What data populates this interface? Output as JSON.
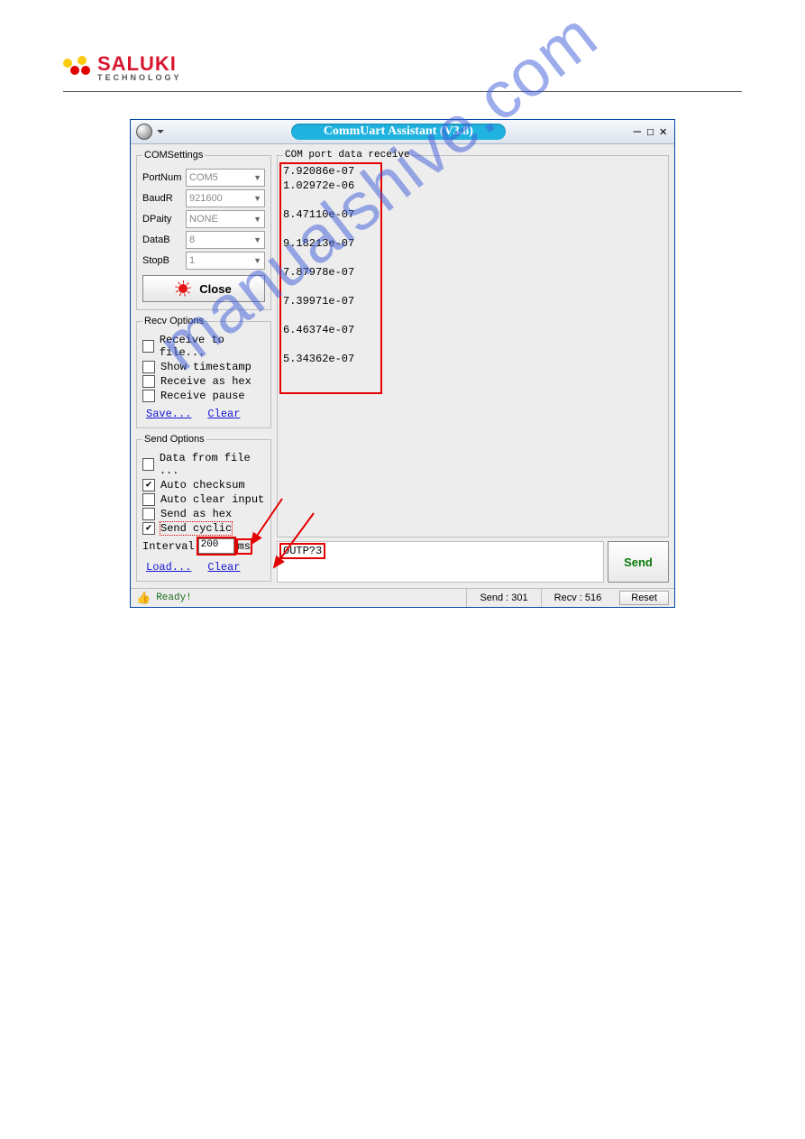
{
  "brand": {
    "name": "SALUKI",
    "tag": "TECHNOLOGY"
  },
  "window": {
    "title": "CommUart Assistant (V3.8)"
  },
  "comsettings": {
    "legend": "COMSettings",
    "portnum": {
      "label": "PortNum",
      "value": "COM5"
    },
    "baudr": {
      "label": "BaudR",
      "value": "921600"
    },
    "dparity": {
      "label": "DPaity",
      "value": "NONE"
    },
    "datab": {
      "label": "DataB",
      "value": "8"
    },
    "stopb": {
      "label": "StopB",
      "value": "1"
    },
    "close_label": "Close"
  },
  "recvopt": {
    "legend": "Recv Options",
    "to_file": "Receive to file...",
    "timestamp": "Show timestamp",
    "as_hex": "Receive as hex",
    "pause": "Receive pause",
    "save": "Save...",
    "clear": "Clear"
  },
  "sendopt": {
    "legend": "Send Options",
    "from_file": "Data from file ...",
    "auto_checksum": "Auto checksum",
    "auto_clear": "Auto clear input",
    "as_hex": "Send as hex",
    "cyclic": "Send cyclic",
    "interval_lbl": "Interval",
    "interval_val": "200",
    "interval_unit": "ms",
    "load": "Load...",
    "clear": "Clear"
  },
  "receive": {
    "legend": "COM port data receive",
    "lines": [
      "7.92086e-07",
      "1.02972e-06",
      "",
      "8.47110e-07",
      "",
      "9.18213e-07",
      "",
      "7.87978e-07",
      "",
      "7.39971e-07",
      "",
      "6.46374e-07",
      "",
      "5.34362e-07"
    ]
  },
  "send": {
    "value": "OUTP?3",
    "button": "Send"
  },
  "status": {
    "ready": "Ready!",
    "send": "Send : 301",
    "recv": "Recv : 516",
    "reset": "Reset"
  },
  "watermark": "manualshive.com"
}
